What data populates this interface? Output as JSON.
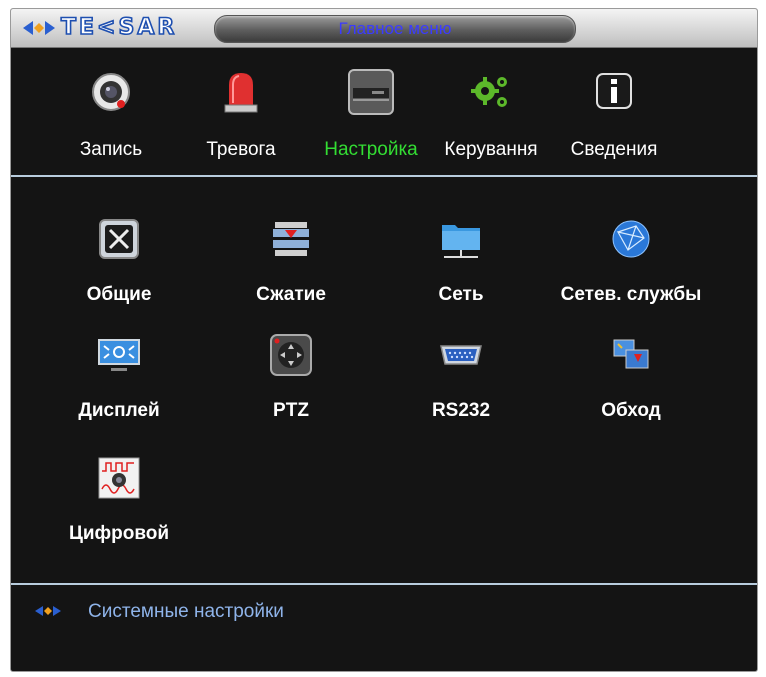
{
  "titlebar": {
    "brand": "TE<SAR",
    "title": "Главное меню"
  },
  "top_menu": [
    {
      "id": "record",
      "label": "Запись",
      "icon": "camera-icon"
    },
    {
      "id": "alarm",
      "label": "Тревога",
      "icon": "alarm-siren-icon"
    },
    {
      "id": "settings",
      "label": "Настройка",
      "icon": "dvr-device-icon",
      "active": true
    },
    {
      "id": "management",
      "label": "Керування",
      "icon": "gears-icon"
    },
    {
      "id": "info",
      "label": "Сведения",
      "icon": "info-icon"
    }
  ],
  "settings_items": [
    {
      "id": "general",
      "label": "Общие",
      "icon": "tools-icon"
    },
    {
      "id": "compression",
      "label": "Сжатие",
      "icon": "compression-icon"
    },
    {
      "id": "network",
      "label": "Сеть",
      "icon": "network-folder-icon"
    },
    {
      "id": "net_services",
      "label": "Сетев. службы",
      "icon": "globe-icon"
    },
    {
      "id": "display",
      "label": "Дисплей",
      "icon": "monitor-icon"
    },
    {
      "id": "ptz",
      "label": "PTZ",
      "icon": "ptz-control-icon"
    },
    {
      "id": "rs232",
      "label": "RS232",
      "icon": "serial-port-icon"
    },
    {
      "id": "tour",
      "label": "Обход",
      "icon": "cameras-switch-icon"
    },
    {
      "id": "digital",
      "label": "Цифровой",
      "icon": "digital-channel-icon"
    }
  ],
  "status": {
    "text": "Системные настройки"
  },
  "colors": {
    "active": "#33dd33",
    "accent": "#8fb4ea",
    "title": "#3b3bff"
  }
}
